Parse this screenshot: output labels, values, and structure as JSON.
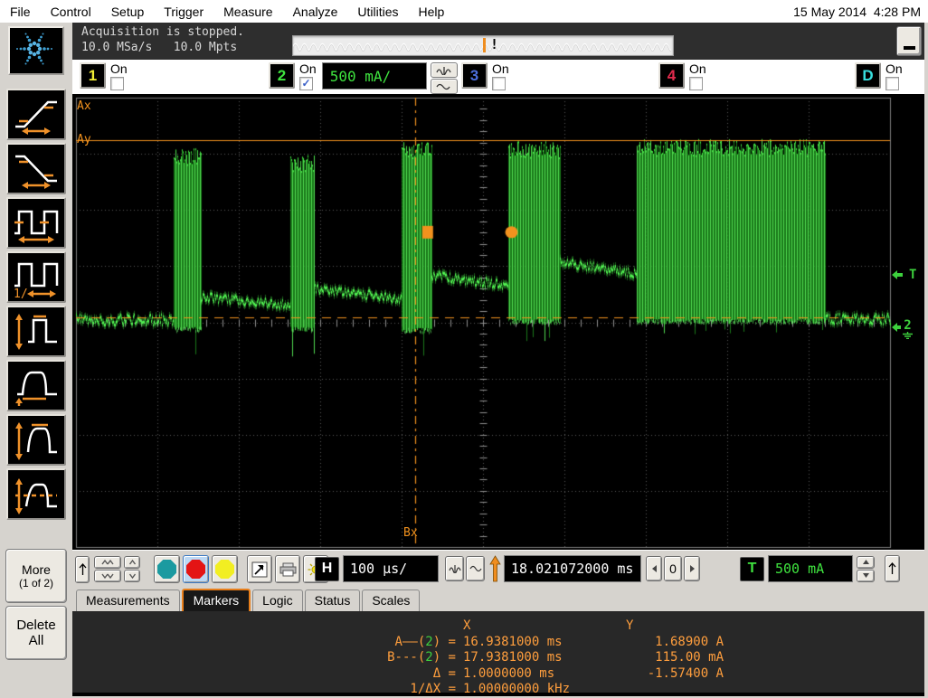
{
  "menu": {
    "items": [
      "File",
      "Control",
      "Setup",
      "Trigger",
      "Measure",
      "Analyze",
      "Utilities",
      "Help"
    ],
    "datetime": "15 May 2014  4:28 PM"
  },
  "acquisition": {
    "status_line": "Acquisition is stopped.",
    "sample_rate": "10.0 MSa/s",
    "memory_depth": "10.0 Mpts",
    "overview_alert": "!"
  },
  "sidebar": {
    "freq_prefix": "1/",
    "more_label": "More",
    "more_count": "(1 of 2)",
    "delete_line1": "Delete",
    "delete_line2": "All"
  },
  "channels": {
    "ch1": {
      "label": "1",
      "on_label": "On",
      "checked": false,
      "color": "#f2ef35"
    },
    "ch2": {
      "label": "2",
      "on_label": "On",
      "checked": true,
      "check_glyph": "✓",
      "scale": "500 mA/",
      "color": "#3fe43f"
    },
    "ch3": {
      "label": "3",
      "on_label": "On",
      "checked": false,
      "color": "#4d6fdd"
    },
    "ch4": {
      "label": "4",
      "on_label": "On",
      "checked": false,
      "color": "#e32b4d"
    },
    "chd": {
      "label": "D",
      "on_label": "On",
      "checked": false,
      "color": "#38e0e0"
    }
  },
  "toolbar": {
    "h_label": "H",
    "timebase": "100 µs/",
    "delay": "18.021072000 ms",
    "zero_label": "0",
    "t_label": "T",
    "trigger_level": "500 mA"
  },
  "tabs": {
    "measurements": "Measurements",
    "markers": "Markers",
    "logic": "Logic",
    "status": "Status",
    "scales": "Scales",
    "active": "Markers"
  },
  "markers_panel": {
    "col_x": "X",
    "col_y": "Y",
    "row_a": {
      "pre": "A——(",
      "chan": "2",
      "post": ") =",
      "x": "16.9381000 ms",
      "y": "1.68900 A"
    },
    "row_b": {
      "pre": "B---(",
      "chan": "2",
      "post": ") =",
      "x": "17.9381000 ms",
      "y": "115.00 mA"
    },
    "row_delta": {
      "label": "Δ =",
      "x": "1.0000000 ms",
      "y": "-1.57400 A"
    },
    "row_freq": {
      "label": "1/ΔX =",
      "x": "1.00000000 kHz",
      "y": ""
    }
  },
  "plot": {
    "ax_label": "Ax",
    "ay_label": "Ay",
    "bx_label": "Bx",
    "trigger_label": "T",
    "ground_channel": "2"
  },
  "chart_data": {
    "type": "line",
    "title": "Oscilloscope channel 2 current trace (bursty load current)",
    "x_unit": "ms",
    "y_unit": "A",
    "x_range": [
      17.521,
      18.521
    ],
    "timebase_per_div": "100 µs",
    "y_per_div_A": 0.5,
    "x_divs": 10,
    "y_divs": 8,
    "ground_y_frac": 0.517,
    "colors": {
      "trace_bright": "#52f452",
      "trace_dark": "#1e911e",
      "grid": "#5c5c5c",
      "marker": "#f2921e"
    },
    "series": [
      {
        "name": "channel-2",
        "color": "#33cc33"
      }
    ],
    "segments": [
      {
        "kind": "noise",
        "t0": 17.521,
        "t1": 17.641,
        "a0": 0.095,
        "a1": 0.09,
        "amp": 0.05
      },
      {
        "kind": "burst",
        "t0": 17.641,
        "t1": 17.674,
        "top": 1.62,
        "bottom": -0.02,
        "spike": -0.26
      },
      {
        "kind": "noise",
        "t0": 17.674,
        "t1": 17.784,
        "a0": 0.3,
        "a1": 0.22,
        "amp": 0.04
      },
      {
        "kind": "burst",
        "t0": 17.784,
        "t1": 17.813,
        "top": 1.56,
        "bottom": -0.02,
        "spike": -0.24
      },
      {
        "kind": "noise",
        "t0": 17.813,
        "t1": 17.921,
        "a0": 0.37,
        "a1": 0.28,
        "amp": 0.04
      },
      {
        "kind": "burst",
        "t0": 17.921,
        "t1": 17.958,
        "top": 1.67,
        "bottom": -0.03,
        "spike": -0.27
      },
      {
        "kind": "noise",
        "t0": 17.958,
        "t1": 18.052,
        "a0": 0.49,
        "a1": 0.4,
        "amp": 0.04
      },
      {
        "kind": "burst",
        "t0": 18.052,
        "t1": 18.115,
        "top": 1.68,
        "bottom": 0.05,
        "spike": -0.1
      },
      {
        "kind": "noise",
        "t0": 18.115,
        "t1": 18.21,
        "a0": 0.61,
        "a1": 0.5,
        "amp": 0.04
      },
      {
        "kind": "burst",
        "t0": 18.21,
        "t1": 18.441,
        "top": 1.7,
        "bottom": 0.05,
        "spike": -0.04
      },
      {
        "kind": "noise",
        "t0": 18.441,
        "t1": 18.521,
        "a0": 0.1,
        "a1": 0.1,
        "amp": 0.045
      }
    ],
    "markers": {
      "ay_A": 1.689,
      "by_A": 0.115,
      "bx_ms": 17.9381,
      "square_handle": {
        "x_ms": 17.953,
        "y_A": 0.87
      },
      "circle_handle": {
        "x_ms": 18.056,
        "y_A": 0.87
      },
      "trigger_level_A": 0.5,
      "ground_A": 0.0
    }
  }
}
